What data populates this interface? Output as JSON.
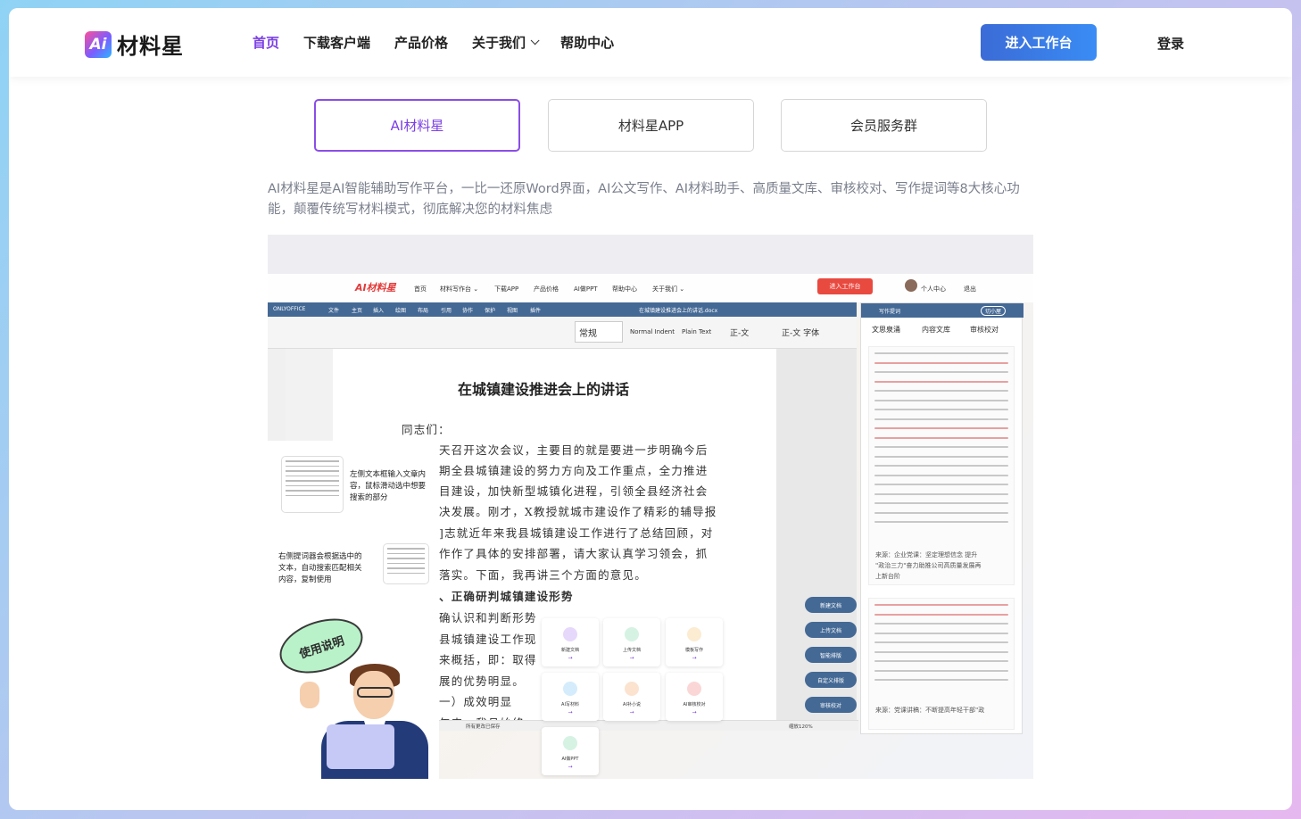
{
  "header": {
    "logo_mark": "Ai",
    "logo_text": "材料星",
    "nav": [
      {
        "label": "首页",
        "active": true
      },
      {
        "label": "下载客户端"
      },
      {
        "label": "产品价格"
      },
      {
        "label": "关于我们",
        "dropdown": true
      },
      {
        "label": "帮助中心"
      }
    ],
    "cta": "进入工作台",
    "login": "登录"
  },
  "tabs": [
    {
      "label": "AI材料星",
      "active": true
    },
    {
      "label": "材料星APP"
    },
    {
      "label": "会员服务群"
    }
  ],
  "description": "AI材料星是AI智能辅助写作平台，一比一还原Word界面，AI公文写作、AI材料助手、高质量文库、审核校对、写作提词等8大核心功能，颠覆传统写材料模式，彻底解决您的材料焦虑",
  "screenshot": {
    "logo": "AI材料星",
    "nav": [
      "首页",
      "材料写作台 ⌄",
      "下载APP",
      "产品价格",
      "AI做PPT",
      "帮助中心",
      "关于我们 ⌄"
    ],
    "cta": "进入工作台",
    "user": "个人中心",
    "logout": "退出",
    "editor_brand": "ONLYOFFICE",
    "editor_menu": [
      "文件",
      "主页",
      "插入",
      "绘图",
      "布局",
      "引用",
      "协作",
      "保护",
      "视图",
      "插件"
    ],
    "file_name": "在城镇建设推进会上的讲话.docx",
    "styles": [
      "常规",
      "Normal Indent",
      "Plain Text",
      "正-文",
      "正-文 字体"
    ],
    "doc_title": "在城镇建设推进会上的讲话",
    "doc_lines": [
      "同志们：",
      "天召开这次会议，主要目的就是要进一步明确今后",
      "期全县城镇建设的努力方向及工作重点，全力推进",
      "目建设，加快新型城镇化进程，引领全县经济社会",
      "决发展。刚才，X教授就城市建设作了精彩的辅导报",
      "]志就近年来我县城镇建设工作进行了总结回顾，对",
      "作作了具体的安排部署，请大家认真学习领会，抓",
      "落实。下面，我再讲三个方面的意见。",
      "、正确研判城镇建设形势",
      "确认识和判断形势",
      "县城镇建设工作现",
      "来概括，即：取得",
      "展的优势明显。",
      "一）成效明显",
      "年来，我县始终"
    ],
    "panel_title": "写作提词",
    "panel_switch": "切小屋",
    "panel_tabs": [
      "文思泉涌",
      "内容文库",
      "审核校对"
    ],
    "source1": "来源：企业党课：坚定理想信念 提升",
    "source1b": "\"政治三力\"奋力助推公司高质量发展再",
    "source1c": "上新台阶",
    "source2": "来源：党课讲稿：不断提高年轻干部\"政",
    "annot_1": "左侧文本框输入文章内容，鼠标滑动选中想要搜索的部分",
    "annot_2": "右侧提词器会根据选中的文本，自动搜索匹配相关内容，复制使用",
    "bubble": "使用说明",
    "features": [
      "新建文档",
      "上传文档",
      "模板写作",
      "AI写材料",
      "AI补小说",
      "AI审核校对",
      "AI做PPT"
    ],
    "side_buttons": [
      "新建文档",
      "上传文档",
      "智能排版",
      "自定义排版",
      "审核校对"
    ],
    "status": "所有更改已保存",
    "zoom": "缩放120%",
    "colors": {
      "accent": "#7b3fe4",
      "brand_red": "#e84a40",
      "editor_blue": "#446995"
    }
  }
}
